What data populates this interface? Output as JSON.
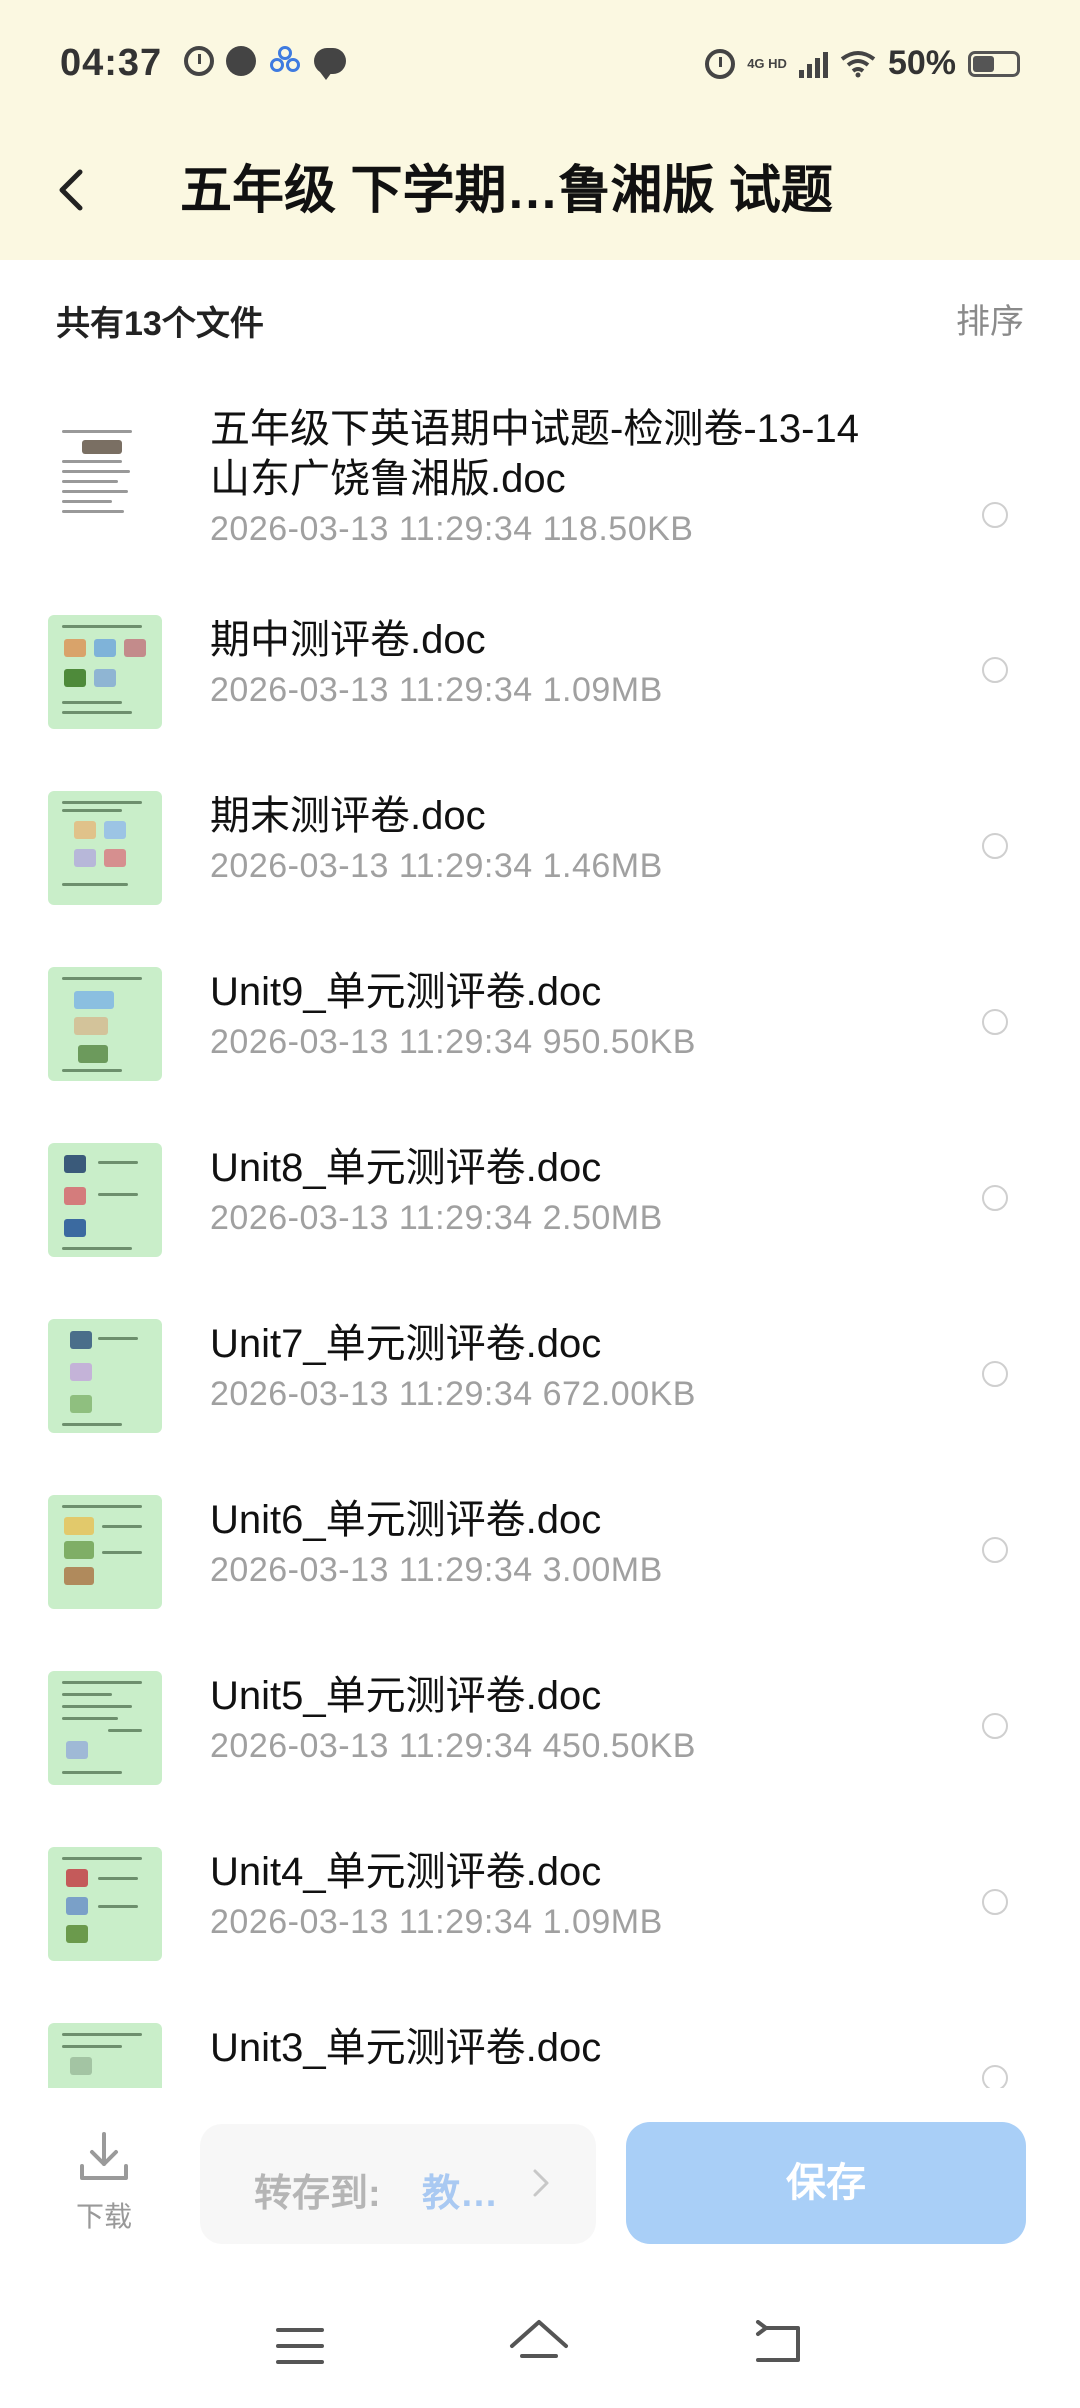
{
  "status_bar": {
    "time": "04:37",
    "network_line1": "4G HD",
    "battery_percent": "50%",
    "icons": [
      "alarm-icon",
      "notification-dot-icon",
      "app-triad-icon",
      "chat-bubble-icon",
      "alarm-icon",
      "signal-icon",
      "wifi-icon",
      "battery-icon"
    ]
  },
  "header": {
    "back_icon": "chevron-left-icon",
    "title": "五年级 下学期…鲁湘版 试题"
  },
  "summary": {
    "count_text": "共有13个文件",
    "sort_label": "排序"
  },
  "files": [
    {
      "name_line1": "五年级下英语期中试题-检测卷-13-14",
      "name_line2": "山东广饶鲁湘版.doc",
      "meta": "2026-03-13  11:29:34  118.50KB",
      "thumb_style": "document"
    },
    {
      "name_line1": "期中测评卷.doc",
      "meta": "2026-03-13  11:29:34  1.09MB",
      "thumb_style": "green"
    },
    {
      "name_line1": "期末测评卷.doc",
      "meta": "2026-03-13  11:29:34  1.46MB",
      "thumb_style": "green"
    },
    {
      "name_line1": "Unit9_单元测评卷.doc",
      "meta": "2026-03-13  11:29:34  950.50KB",
      "thumb_style": "green"
    },
    {
      "name_line1": "Unit8_单元测评卷.doc",
      "meta": "2026-03-13  11:29:34  2.50MB",
      "thumb_style": "green"
    },
    {
      "name_line1": "Unit7_单元测评卷.doc",
      "meta": "2026-03-13  11:29:34  672.00KB",
      "thumb_style": "green"
    },
    {
      "name_line1": "Unit6_单元测评卷.doc",
      "meta": "2026-03-13  11:29:34  3.00MB",
      "thumb_style": "green"
    },
    {
      "name_line1": "Unit5_单元测评卷.doc",
      "meta": "2026-03-13  11:29:34  450.50KB",
      "thumb_style": "green"
    },
    {
      "name_line1": "Unit4_单元测评卷.doc",
      "meta": "2026-03-13  11:29:34  1.09MB",
      "thumb_style": "green"
    },
    {
      "name_line1": "Unit3_单元测评卷.doc",
      "meta": "",
      "thumb_style": "green"
    }
  ],
  "bottom_bar": {
    "download_label": "下载",
    "transfer_label": "转存到:",
    "transfer_target": "教…",
    "save_label": "保存"
  },
  "nav_bar": {
    "icons": [
      "menu-icon",
      "home-icon",
      "back-icon"
    ]
  },
  "colors": {
    "header_bg": "#fbf8e1",
    "save_button_bg": "#a9cff7",
    "thumb_bg": "#c9eec9",
    "meta_text": "#a0a0a0"
  }
}
